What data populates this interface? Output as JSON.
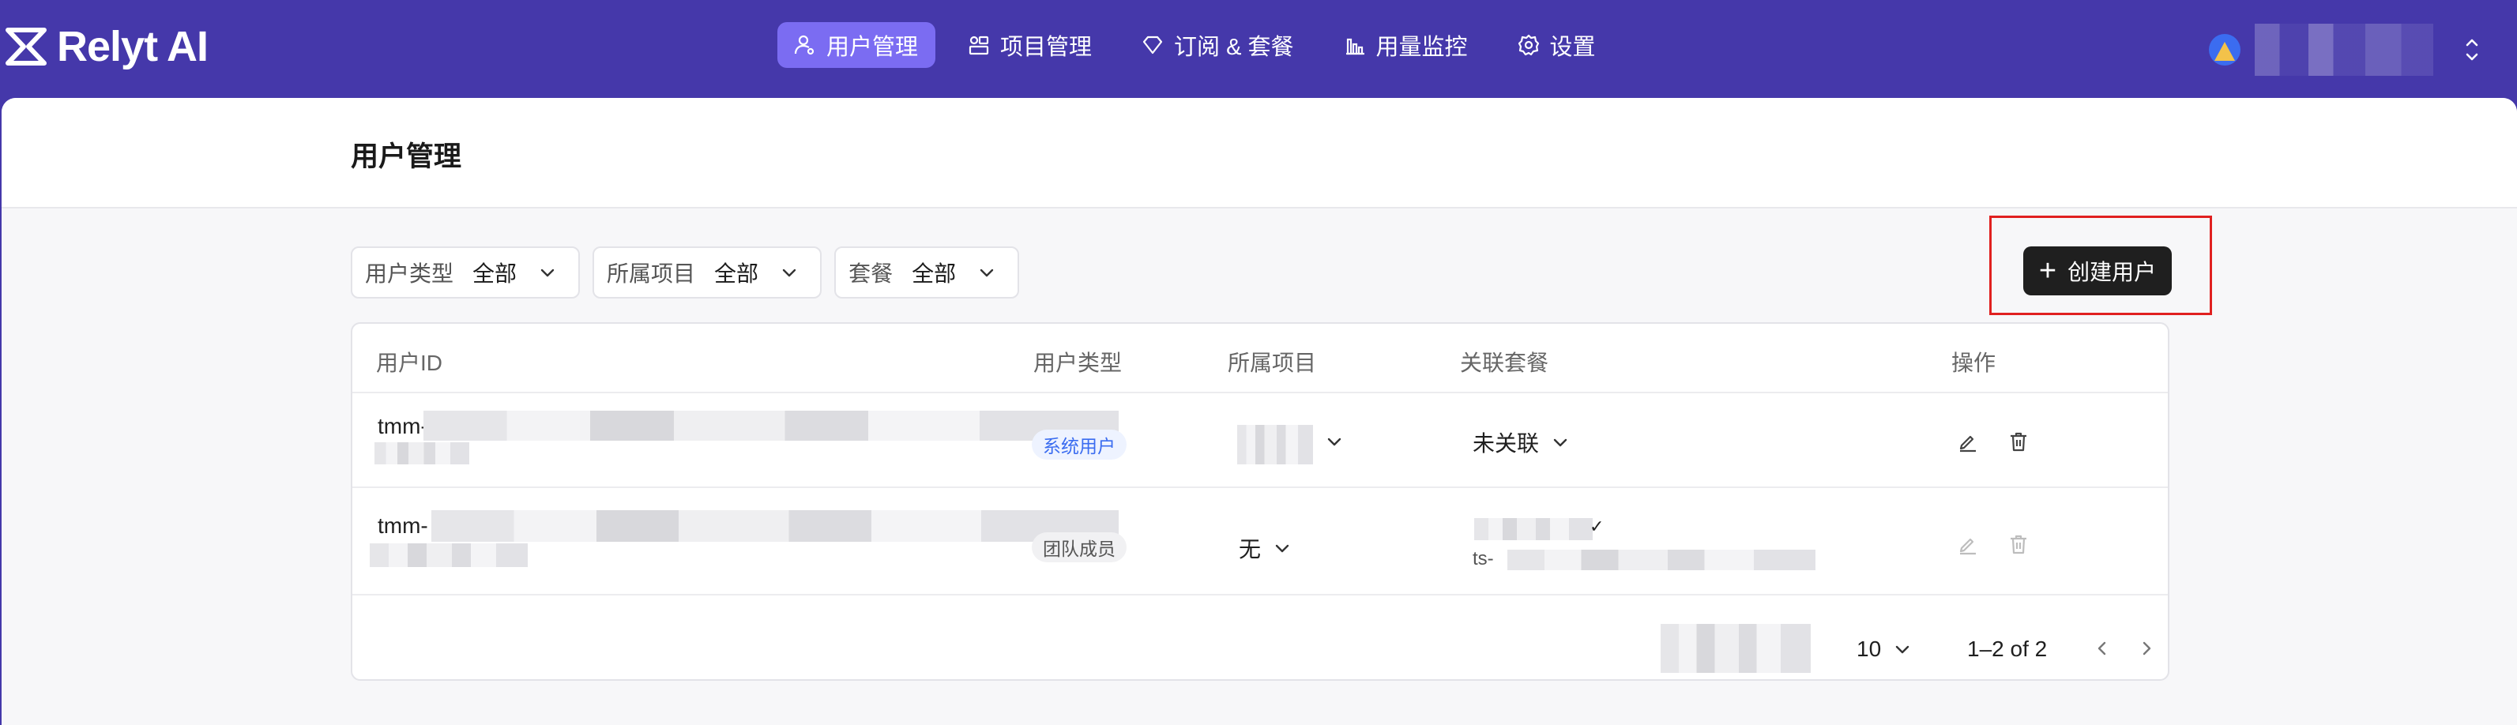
{
  "brand": {
    "name": "Relyt AI"
  },
  "nav": [
    {
      "label": "用户管理",
      "icon": "user-settings-icon",
      "active": true
    },
    {
      "label": "项目管理",
      "icon": "project-icon",
      "active": false
    },
    {
      "label": "订阅 & 套餐",
      "icon": "diamond-icon",
      "active": false
    },
    {
      "label": "用量监控",
      "icon": "bar-chart-icon",
      "active": false
    },
    {
      "label": "设置",
      "icon": "gear-icon",
      "active": false
    }
  ],
  "page": {
    "title": "用户管理"
  },
  "filters": [
    {
      "label": "用户类型",
      "value": "全部"
    },
    {
      "label": "所属项目",
      "value": "全部"
    },
    {
      "label": "套餐",
      "value": "全部"
    }
  ],
  "create_button": {
    "label": "创建用户"
  },
  "table": {
    "columns": [
      "用户ID",
      "用户类型",
      "所属项目",
      "关联套餐",
      "操作"
    ],
    "rows": [
      {
        "user_id": "tmm-",
        "user_type": "系统用户",
        "project": "",
        "plan": "未关联",
        "plan_sub": ""
      },
      {
        "user_id": "tmm-",
        "user_type": "团队成员",
        "project": "无",
        "plan": "",
        "plan_sub": "ts-"
      }
    ]
  },
  "pagination": {
    "page_size": "10",
    "range": "1–2 of 2"
  },
  "colors": {
    "nav_bg": "#4538aa",
    "nav_active": "#7b6cf2",
    "primary_button": "#1f1f1f",
    "highlight_border": "#e02020"
  }
}
